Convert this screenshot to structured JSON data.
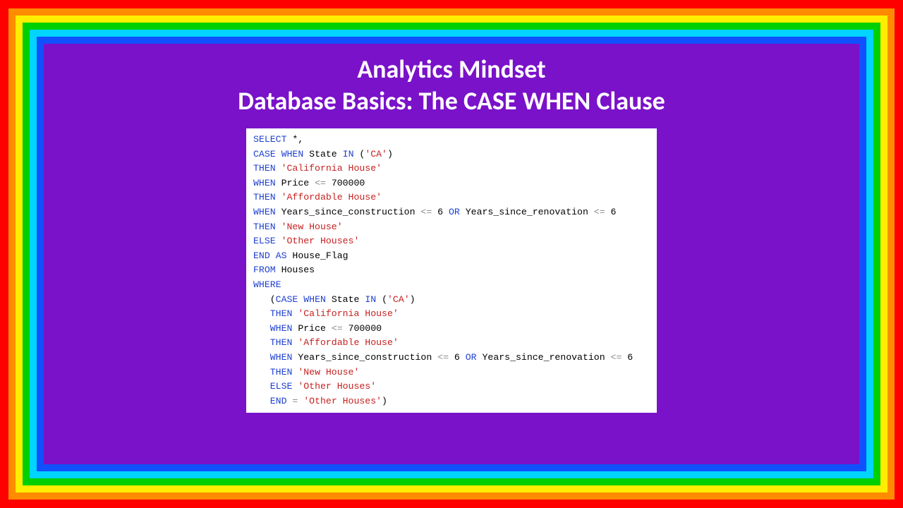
{
  "title": {
    "line1": "Analytics Mindset",
    "line2": "Database Basics: The CASE WHEN Clause"
  },
  "code": {
    "indent": "   ",
    "kw": {
      "select": "SELECT",
      "case": "CASE",
      "when": "WHEN",
      "in": "IN",
      "then": "THEN",
      "else": "ELSE",
      "end": "END",
      "as": "AS",
      "from": "FROM",
      "where": "WHERE",
      "or": "OR"
    },
    "ids": {
      "state": "State",
      "price": "Price",
      "ysc": "Years_since_construction",
      "ysr": "Years_since_renovation",
      "houseflag": "House_Flag",
      "houses": "Houses"
    },
    "strs": {
      "ca": "'CA'",
      "cal": "'California House'",
      "aff": "'Affordable House'",
      "newh": "'New House'",
      "other": "'Other Houses'"
    },
    "ops": {
      "star_comma": " *,",
      "open_paren": " (",
      "close_paren": ")",
      "le": " <=",
      "eq": " = ",
      "sp": " ",
      "n700000": " 700000",
      "n6": " 6",
      "open_paren2": "("
    }
  }
}
